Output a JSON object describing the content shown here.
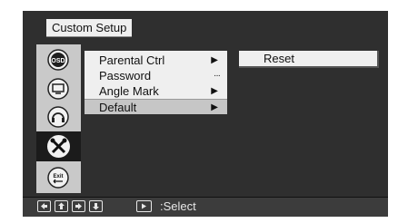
{
  "header": {
    "title": "Custom Setup"
  },
  "sidebar": {
    "items": [
      {
        "icon": "osd-icon",
        "label": "OSD"
      },
      {
        "icon": "tv-icon"
      },
      {
        "icon": "headphone-icon"
      },
      {
        "icon": "tools-icon",
        "active": true
      },
      {
        "icon": "exit-icon",
        "label": "Exit"
      }
    ]
  },
  "submenu": {
    "items": [
      {
        "label": "Parental Ctrl",
        "indicator": "▶"
      },
      {
        "label": "Password",
        "indicator": "···"
      },
      {
        "label": "Angle Mark",
        "indicator": "▶"
      },
      {
        "label": "Default",
        "indicator": "▶",
        "selected": true
      }
    ]
  },
  "option": {
    "label": "Reset"
  },
  "footer": {
    "select_label": ":Select"
  },
  "colors": {
    "background": "#2f2f2f",
    "panel": "#efefef",
    "sidebar": "#c9c9c9",
    "highlight": "#c6c6c6"
  }
}
